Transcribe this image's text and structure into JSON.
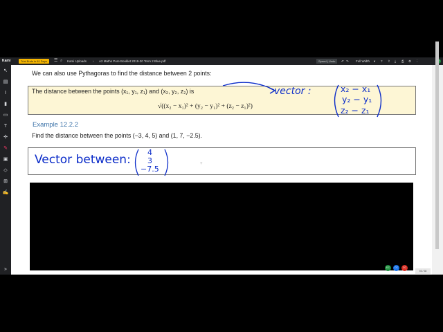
{
  "app": {
    "logo": "Kami",
    "trial_badge": "Trial Ends in 61 Days",
    "breadcrumb_root": "Kami Uploads",
    "breadcrumb_sep": "›",
    "file_name": "A2 Maths Pure Booklet 2019-20 Term 2 Blue.pdf",
    "speed_label": "Speed | Undo",
    "zoom_label": "Full Width",
    "avatar_initials": "AY",
    "page_indicator": "56 / 68"
  },
  "icons": {
    "menu": "menu-icon",
    "search": "search-icon"
  },
  "sidebar": {
    "items": [
      "pointer-icon",
      "book-icon",
      "text-select-icon",
      "highlight-icon",
      "comment-icon",
      "text-icon",
      "equation-icon",
      "pen-icon",
      "image-icon",
      "eraser-icon",
      "add-page-icon",
      "signature-icon",
      "expand-icon"
    ]
  },
  "document": {
    "intro": "We can also use Pythagoras to find the distance between 2 points:",
    "definition": "The distance between the points (x₁, y₁, z₁) and (x₂, y₂, z₂) is",
    "formula": "√((x₂ − x₁)² + (y₂ − y₁)² + (z₂ − z₁)²)",
    "example_heading": "Example 12.2.2",
    "example_text": "Find the distance between the points (−3, 4, 5) and (1, 7, −2.5)."
  },
  "annotations": {
    "vector_label": "vector :",
    "vector_row1": "x₂ − x₁",
    "vector_row2": "y₂ − y₁",
    "vector_row3": "z₂ − z₁",
    "vector_between": "Vector between:",
    "vb_row1": "4",
    "vb_row2": "3",
    "vb_row3": "−7.5"
  },
  "collaborators": [
    {
      "initials": "DC",
      "color": "#1e8e3e"
    },
    {
      "initials": "CC",
      "color": "#1a73e8"
    },
    {
      "initials": "CC",
      "color": "#d93025"
    }
  ]
}
